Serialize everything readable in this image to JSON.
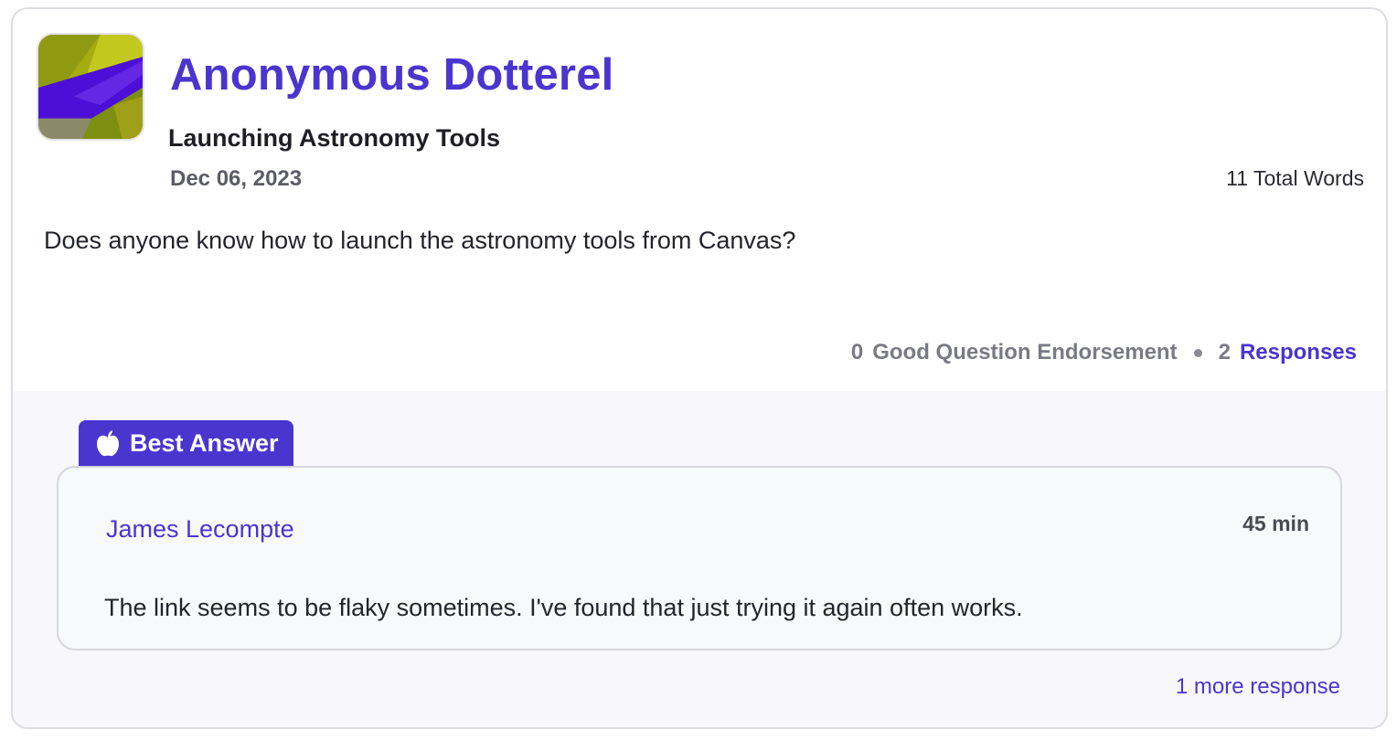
{
  "post": {
    "author": "Anonymous Dotterel",
    "title": "Launching Astronomy Tools",
    "date": "Dec 06, 2023",
    "word_count": "11 Total Words",
    "body": "Does anyone know how to launch the astronomy tools from Canvas?",
    "endorsement_count": "0",
    "endorsement_label": "Good Question Endorsement",
    "response_count": "2",
    "responses_label": "Responses"
  },
  "best_answer": {
    "badge_label": "Best Answer",
    "badge_icon": "apple-icon",
    "author": "James Lecompte",
    "time": "45 min",
    "body": "The link seems to be flaky sometimes. I've found that just trying it again often works."
  },
  "more_responses_label": "1 more response",
  "colors": {
    "accent": "#4a35cf",
    "answers_background": "#f7f7fc",
    "avatar_olive": "#a6ab10",
    "avatar_purple": "#4b0fd8"
  }
}
